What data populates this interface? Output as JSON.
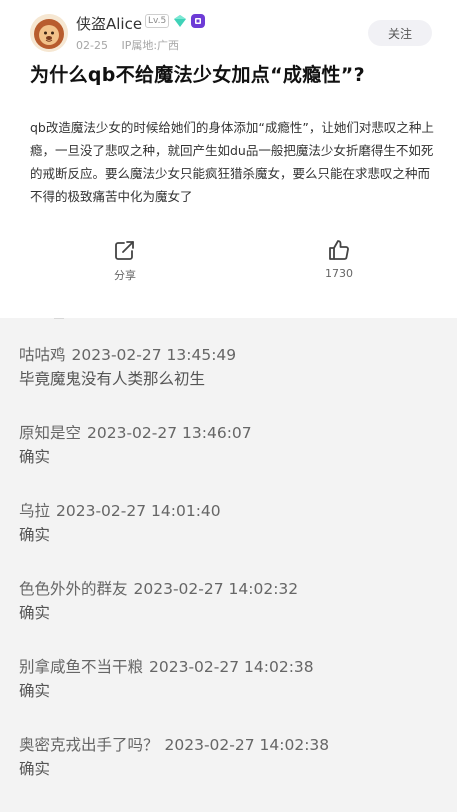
{
  "post": {
    "author": {
      "name": "侠盗Alice",
      "level": "Lv.5",
      "date": "02-25",
      "ip": "IP属地:广西"
    },
    "follow_label": "关注",
    "title": "为什么qb不给魔法少女加点“成瘾性”?",
    "body": "qb改造魔法少女的时候给她们的身体添加“成瘾性”，让她们对悲叹之种上瘾，一旦没了悲叹之种，就回产生如du品一般把魔法少女折磨得生不如死的戒断反应。要么魔法少女只能疯狂猎杀魔女，要么只能在求悲叹之种而不得的极致痛苦中化为魔女了",
    "actions": {
      "share_label": "分享",
      "like_count": "1730"
    }
  },
  "comments": [
    {
      "user": "咕咕鸡",
      "time": "2023-02-27 13:45:49",
      "text": "毕竟魔鬼没有人类那么初生"
    },
    {
      "user": "原知是空",
      "time": "2023-02-27 13:46:07",
      "text": "确实"
    },
    {
      "user": "乌拉",
      "time": "2023-02-27 14:01:40",
      "text": "确实"
    },
    {
      "user": "色色外外的群友",
      "time": "2023-02-27 14:02:32",
      "text": "确实"
    },
    {
      "user": "别拿咸鱼不当干粮",
      "time": "2023-02-27 14:02:38",
      "text": "确实"
    },
    {
      "user": "奥密克戎出手了吗？",
      "time": "2023-02-27 14:02:38",
      "text": "确实"
    }
  ],
  "colors": {
    "background": "#f3f3f3",
    "card": "#ffffff",
    "follow_bg": "#f1f1f5",
    "gem": "#3fd2b8",
    "purple_badge": "#6d3bd6"
  }
}
